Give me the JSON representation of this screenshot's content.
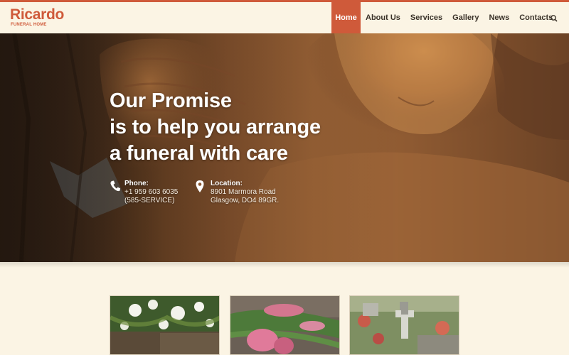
{
  "brand": {
    "name": "Ricardo",
    "tagline": "FUNERAL HOME"
  },
  "nav": {
    "items": [
      {
        "label": "Home",
        "active": true
      },
      {
        "label": "About Us",
        "active": false
      },
      {
        "label": "Services",
        "active": false
      },
      {
        "label": "Gallery",
        "active": false
      },
      {
        "label": "News",
        "active": false
      },
      {
        "label": "Contacts",
        "active": false
      }
    ],
    "search_icon": "search-icon"
  },
  "hero": {
    "headline": [
      "Our Promise",
      "is to help you arrange",
      "a funeral with care"
    ],
    "phone": {
      "label": "Phone:",
      "lines": [
        "+1 959 603 6035",
        "(585-SERVICE)"
      ],
      "icon": "phone-icon"
    },
    "location": {
      "label": "Location:",
      "lines": [
        "8901 Marmora Road",
        "Glasgow, DO4 89GR."
      ],
      "icon": "map-pin-icon"
    }
  },
  "cards": [
    {
      "subject": "white-flower-arrangement-photo"
    },
    {
      "subject": "pink-tulips-photo"
    },
    {
      "subject": "cemetery-cross-photo"
    }
  ],
  "colors": {
    "accent": "#cf5a3a",
    "background": "#fbf4e4",
    "nav_text": "#3b332a"
  }
}
